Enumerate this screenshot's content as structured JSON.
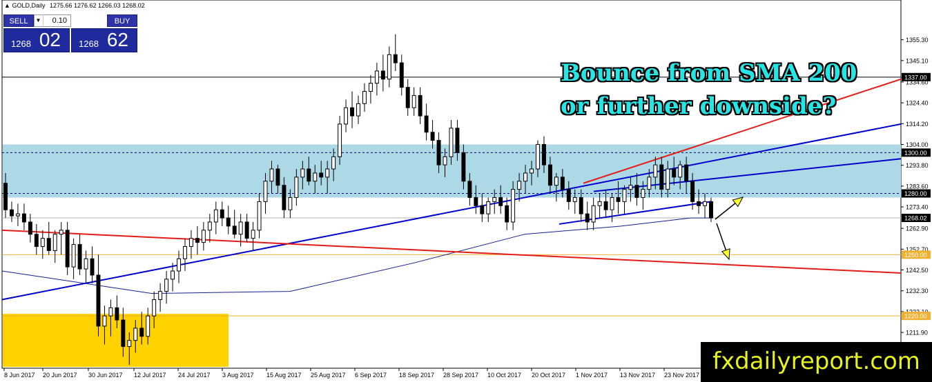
{
  "header": {
    "symbol": "GOLD,Daily",
    "ohlc": "1275.66 1276.62 1266.03 1268.02"
  },
  "trade_panel": {
    "sell_label": "SELL",
    "buy_label": "BUY",
    "lot": "0.10",
    "sell_small": "1268",
    "sell_big": "02",
    "buy_small": "1268",
    "buy_big": "62"
  },
  "annotation": {
    "line1": "Bounce from SMA 200",
    "line2": "or further downside?"
  },
  "brand": "fxdailyreport.com",
  "colors": {
    "zone": "#add8e6",
    "support_zone": "#ffd200",
    "trend_blue": "#0000cc",
    "trend_red": "#e41b17",
    "sma": "#141e8c",
    "arrow": "#ffff33"
  },
  "chart_data": {
    "type": "candlestick",
    "ylim": [
      1212,
      1362
    ],
    "price_ticks": [
      "1355.30",
      "1345.10",
      "1334.60",
      "1324.40",
      "1314.20",
      "1304.00",
      "1293.80",
      "1283.60",
      "1273.40",
      "1262.90",
      "1252.70",
      "1242.50",
      "1232.30",
      "1222.10",
      "1211.90"
    ],
    "x_labels": [
      "8 Jun 2017",
      "20 Jun 2017",
      "30 Jun 2017",
      "12 Jul 2017",
      "24 Jul 2017",
      "3 Aug 2017",
      "15 Aug 2017",
      "25 Aug 2017",
      "6 Sep 2017",
      "18 Sep 2017",
      "28 Sep 2017",
      "10 Oct 2017",
      "20 Oct 2017",
      "1 Nov 2017",
      "13 Nov 2017",
      "23 Nov 2017"
    ],
    "levels": [
      {
        "price": 1337.0,
        "label": "1337.00",
        "style": "solid",
        "color": "#000000"
      },
      {
        "price": 1300.0,
        "label": "1300.00",
        "style": "dashed",
        "color": "#000080"
      },
      {
        "price": 1280.0,
        "label": "1280.00",
        "style": "dashed",
        "color": "#000080"
      },
      {
        "price": 1268.02,
        "label": "1268.02",
        "style": "solid",
        "color": "#b0b0b0"
      },
      {
        "price": 1250.0,
        "label": "1250.00",
        "style": "solid",
        "color": "#f0b030"
      },
      {
        "price": 1220.0,
        "label": "1220.00",
        "style": "solid",
        "color": "#f0b030"
      }
    ],
    "zones": [
      {
        "from": 1278,
        "to": 1304,
        "color": "#add8e6"
      },
      {
        "from": 1195,
        "to": 1221,
        "color": "#ffd200",
        "end": "3 Aug 2017"
      }
    ],
    "candles": [
      [
        1285,
        1290,
        1268,
        1272
      ],
      [
        1272,
        1276,
        1266,
        1269
      ],
      [
        1269,
        1275,
        1264,
        1270
      ],
      [
        1270,
        1275,
        1262,
        1266
      ],
      [
        1266,
        1270,
        1256,
        1260
      ],
      [
        1260,
        1265,
        1250,
        1254
      ],
      [
        1254,
        1262,
        1248,
        1258
      ],
      [
        1258,
        1266,
        1250,
        1252
      ],
      [
        1252,
        1262,
        1246,
        1260
      ],
      [
        1260,
        1266,
        1250,
        1262
      ],
      [
        1262,
        1266,
        1240,
        1244
      ],
      [
        1244,
        1258,
        1238,
        1255
      ],
      [
        1255,
        1260,
        1240,
        1243
      ],
      [
        1243,
        1252,
        1236,
        1248
      ],
      [
        1248,
        1254,
        1236,
        1240
      ],
      [
        1240,
        1250,
        1210,
        1215
      ],
      [
        1215,
        1225,
        1206,
        1220
      ],
      [
        1220,
        1228,
        1210,
        1224
      ],
      [
        1224,
        1230,
        1214,
        1218
      ],
      [
        1218,
        1224,
        1200,
        1205
      ],
      [
        1205,
        1212,
        1196,
        1208
      ],
      [
        1208,
        1218,
        1202,
        1214
      ],
      [
        1214,
        1222,
        1206,
        1210
      ],
      [
        1210,
        1224,
        1206,
        1220
      ],
      [
        1220,
        1232,
        1214,
        1228
      ],
      [
        1228,
        1236,
        1222,
        1232
      ],
      [
        1232,
        1242,
        1226,
        1238
      ],
      [
        1238,
        1246,
        1232,
        1242
      ],
      [
        1242,
        1252,
        1236,
        1248
      ],
      [
        1248,
        1258,
        1242,
        1254
      ],
      [
        1254,
        1262,
        1248,
        1258
      ],
      [
        1258,
        1264,
        1250,
        1256
      ],
      [
        1256,
        1266,
        1252,
        1262
      ],
      [
        1262,
        1270,
        1256,
        1266
      ],
      [
        1266,
        1276,
        1260,
        1272
      ],
      [
        1272,
        1276,
        1264,
        1268
      ],
      [
        1268,
        1274,
        1260,
        1264
      ],
      [
        1264,
        1272,
        1258,
        1260
      ],
      [
        1260,
        1270,
        1254,
        1266
      ],
      [
        1266,
        1270,
        1256,
        1258
      ],
      [
        1258,
        1266,
        1252,
        1262
      ],
      [
        1262,
        1280,
        1258,
        1276
      ],
      [
        1276,
        1290,
        1270,
        1286
      ],
      [
        1286,
        1296,
        1280,
        1292
      ],
      [
        1292,
        1294,
        1280,
        1284
      ],
      [
        1284,
        1288,
        1268,
        1272
      ],
      [
        1272,
        1282,
        1268,
        1278
      ],
      [
        1278,
        1292,
        1274,
        1288
      ],
      [
        1288,
        1296,
        1282,
        1292
      ],
      [
        1292,
        1298,
        1284,
        1286
      ],
      [
        1286,
        1294,
        1280,
        1290
      ],
      [
        1290,
        1296,
        1284,
        1288
      ],
      [
        1288,
        1296,
        1280,
        1292
      ],
      [
        1292,
        1302,
        1286,
        1298
      ],
      [
        1298,
        1318,
        1294,
        1314
      ],
      [
        1314,
        1326,
        1310,
        1322
      ],
      [
        1322,
        1330,
        1312,
        1318
      ],
      [
        1318,
        1328,
        1314,
        1324
      ],
      [
        1324,
        1334,
        1320,
        1330
      ],
      [
        1330,
        1338,
        1324,
        1334
      ],
      [
        1334,
        1344,
        1328,
        1340
      ],
      [
        1340,
        1348,
        1330,
        1336
      ],
      [
        1336,
        1352,
        1332,
        1348
      ],
      [
        1348,
        1358,
        1340,
        1344
      ],
      [
        1344,
        1348,
        1328,
        1332
      ],
      [
        1332,
        1336,
        1318,
        1322
      ],
      [
        1322,
        1332,
        1318,
        1328
      ],
      [
        1328,
        1332,
        1314,
        1318
      ],
      [
        1318,
        1324,
        1306,
        1310
      ],
      [
        1310,
        1316,
        1302,
        1306
      ],
      [
        1306,
        1310,
        1290,
        1294
      ],
      [
        1294,
        1302,
        1288,
        1298
      ],
      [
        1298,
        1316,
        1294,
        1312
      ],
      [
        1312,
        1316,
        1296,
        1300
      ],
      [
        1300,
        1304,
        1282,
        1286
      ],
      [
        1286,
        1290,
        1274,
        1278
      ],
      [
        1278,
        1284,
        1270,
        1274
      ],
      [
        1274,
        1280,
        1266,
        1270
      ],
      [
        1270,
        1278,
        1266,
        1276
      ],
      [
        1276,
        1282,
        1270,
        1278
      ],
      [
        1278,
        1284,
        1270,
        1274
      ],
      [
        1274,
        1278,
        1262,
        1266
      ],
      [
        1266,
        1286,
        1262,
        1282
      ],
      [
        1282,
        1290,
        1276,
        1286
      ],
      [
        1286,
        1294,
        1280,
        1290
      ],
      [
        1290,
        1296,
        1284,
        1292
      ],
      [
        1292,
        1306,
        1288,
        1304
      ],
      [
        1304,
        1308,
        1290,
        1294
      ],
      [
        1294,
        1298,
        1280,
        1284
      ],
      [
        1284,
        1290,
        1276,
        1288
      ],
      [
        1288,
        1292,
        1278,
        1282
      ],
      [
        1282,
        1286,
        1272,
        1276
      ],
      [
        1276,
        1282,
        1270,
        1278
      ],
      [
        1278,
        1282,
        1266,
        1270
      ],
      [
        1270,
        1276,
        1262,
        1266
      ],
      [
        1266,
        1278,
        1262,
        1274
      ],
      [
        1274,
        1280,
        1268,
        1276
      ],
      [
        1276,
        1282,
        1268,
        1272
      ],
      [
        1272,
        1280,
        1266,
        1278
      ],
      [
        1278,
        1286,
        1270,
        1276
      ],
      [
        1276,
        1284,
        1270,
        1282
      ],
      [
        1282,
        1288,
        1276,
        1284
      ],
      [
        1284,
        1290,
        1274,
        1278
      ],
      [
        1278,
        1286,
        1272,
        1282
      ],
      [
        1282,
        1292,
        1278,
        1288
      ],
      [
        1288,
        1298,
        1282,
        1294
      ],
      [
        1294,
        1298,
        1278,
        1282
      ],
      [
        1282,
        1296,
        1278,
        1292
      ],
      [
        1292,
        1298,
        1284,
        1288
      ],
      [
        1288,
        1296,
        1282,
        1294
      ],
      [
        1294,
        1298,
        1280,
        1286
      ],
      [
        1286,
        1290,
        1272,
        1276
      ],
      [
        1276,
        1282,
        1270,
        1274
      ],
      [
        1274,
        1280,
        1268,
        1276
      ],
      [
        1276,
        1278,
        1266,
        1268
      ]
    ],
    "sma200": [
      [
        1232,
        1241
      ],
      [
        1240,
        1234
      ],
      [
        1250,
        1236
      ],
      [
        1280,
        1250
      ],
      [
        1300,
        1260
      ],
      [
        1320,
        1264
      ],
      [
        1340,
        1268
      ],
      [
        1360,
        1268
      ]
    ],
    "trendlines": [
      {
        "color": "#0000cc",
        "points": [
          [
            0,
            1230
          ],
          [
            1310,
            1312
          ]
        ]
      },
      {
        "color": "#0000cc",
        "points": [
          [
            0,
            1230
          ],
          [
            1310,
            1296
          ]
        ]
      },
      {
        "color": "#0000cc",
        "points": [
          [
            810,
            1266
          ],
          [
            1310,
            1296
          ]
        ]
      },
      {
        "color": "#e41b17",
        "points": [
          [
            0,
            1260
          ],
          [
            1310,
            1240
          ]
        ]
      },
      {
        "color": "#e41b17",
        "points": [
          [
            840,
            1286
          ],
          [
            1310,
            1336
          ]
        ]
      }
    ],
    "arrows": [
      {
        "from": [
          1036,
          1270
        ],
        "to": [
          1078,
          1278
        ]
      },
      {
        "from": [
          1036,
          1266
        ],
        "to": [
          1058,
          1250
        ]
      }
    ]
  }
}
